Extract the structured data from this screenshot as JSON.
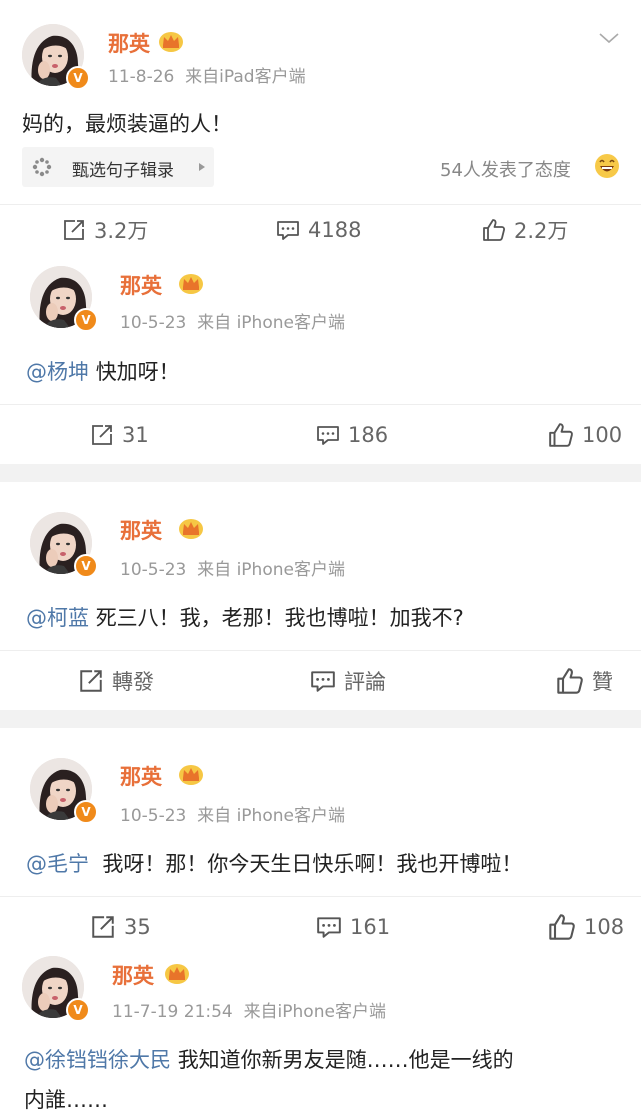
{
  "posts": [
    {
      "name": "那英",
      "date": "11-8-26",
      "source": "来自iPad客户端",
      "text": "妈的，最烦装逼的人！",
      "card_label": "甄选句子辑录",
      "attitude_text": "54人发表了态度",
      "repost": "3.2万",
      "comment": "4188",
      "like": "2.2万"
    },
    {
      "name": "那英",
      "date": "10-5-23",
      "source": "来自 iPhone客户端",
      "mention": "@杨坤",
      "text": "快加呀！",
      "repost": "31",
      "comment": "186",
      "like": "100"
    },
    {
      "name": "那英",
      "date": "10-5-23",
      "source": "来自 iPhone客户端",
      "mention": "@柯蓝",
      "text": "死三八！我，老那！我也博啦！加我不?",
      "repost": "轉發",
      "comment": "評論",
      "like": "贊"
    },
    {
      "name": "那英",
      "date": "10-5-23",
      "source": "来自 iPhone客户端",
      "mention": "@毛宁",
      "text": "我呀！那！你今天生日快乐啊！我也开博啦！",
      "repost": "35",
      "comment": "161",
      "like": "108"
    },
    {
      "name": "那英",
      "date": "11-7-19 21:54",
      "source": "来自iPhone客户端",
      "mention": "@徐铛铛徐大民",
      "text": "我知道你新男友是随……他是一线的",
      "text2": "内誰……"
    }
  ],
  "icons": {
    "verified": "verified-v-icon",
    "crown": "crown-icon",
    "repost": "repost-icon",
    "comment": "comment-icon",
    "like": "like-icon",
    "more": "chevron-down-icon",
    "card": "card-logo-icon",
    "arrow": "arrow-right-icon",
    "emoji": "laughing-emoji-icon"
  },
  "colors": {
    "name": "#e8703a",
    "mention": "#4f78a8",
    "meta": "#999999",
    "badge": "#f08a1a"
  }
}
